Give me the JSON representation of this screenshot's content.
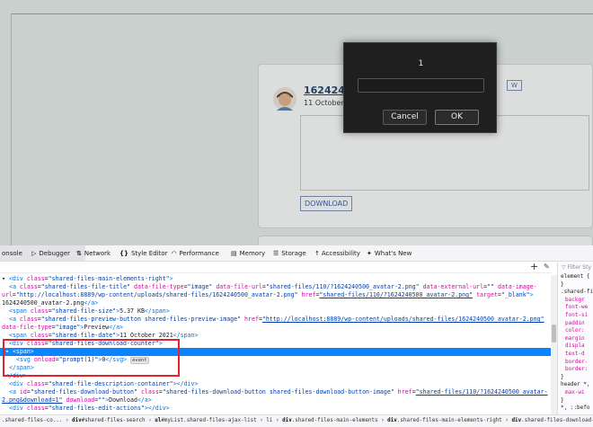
{
  "page": {
    "file_title": "16242405",
    "file_date": "11 October 20",
    "preview_label": "W",
    "download_label": "DOWNLOAD"
  },
  "prompt": {
    "message": "1",
    "input_value": "",
    "cancel_label": "Cancel",
    "ok_label": "OK"
  },
  "devtools": {
    "tabs": [
      "onsole",
      "Debugger",
      "Network",
      "Style Editor",
      "Performance",
      "Memory",
      "Storage",
      "Accessibility",
      "What's New"
    ],
    "tab_icons": [
      "debugger-icon",
      "network-icon",
      "style-editor-icon",
      "performance-icon",
      "memory-icon",
      "storage-icon",
      "accessibility-icon",
      "whats-new-icon"
    ],
    "styles_filter": "Filter Sty",
    "styles_lines": [
      "element {",
      "}",
      ".shared-fi",
      "backgr",
      "font-we",
      "font-si",
      "paddin",
      "color:",
      "margin",
      "displa",
      "text-d",
      "border-",
      "border:",
      "}",
      "header *,",
      "max-wi",
      "}",
      "*, ::befo"
    ],
    "code_lines": [
      {
        "ind": 0,
        "tri": "▾",
        "parts": [
          [
            "tg",
            "<div "
          ],
          [
            "at",
            "class"
          ],
          [
            "tx",
            "="
          ],
          [
            "vl",
            "\"shared-files-main-elements-right\""
          ],
          [
            "tg",
            ">"
          ]
        ]
      },
      {
        "ind": 2,
        "parts": [
          [
            "tg",
            "<a "
          ],
          [
            "at",
            "class"
          ],
          [
            "tx",
            "="
          ],
          [
            "vl",
            "\"shared-files-file-title\" "
          ],
          [
            "at",
            "data-file-type"
          ],
          [
            "tx",
            "="
          ],
          [
            "vl",
            "\"image\" "
          ],
          [
            "at",
            "data-file-url"
          ],
          [
            "tx",
            "="
          ],
          [
            "vl",
            "\"shared-files/110/?1624240500_avatar-2.png\" "
          ],
          [
            "at",
            "data-external-url"
          ],
          [
            "tx",
            "="
          ],
          [
            "vl",
            "\"\" "
          ],
          [
            "at",
            "data-image-"
          ]
        ]
      },
      {
        "ind": 0,
        "parts": [
          [
            "at",
            "url"
          ],
          [
            "tx",
            "="
          ],
          [
            "vl",
            "\"http://localhost:8889/wp-content/uploads/shared-files/1624240500_avatar-2.png\" "
          ],
          [
            "at",
            "href"
          ],
          [
            "tx",
            "="
          ],
          [
            "lk",
            "\"shared-files/110/?1624240500_avatar-2.png\""
          ],
          [
            "tx",
            " "
          ],
          [
            "at",
            "target"
          ],
          [
            "tx",
            "="
          ],
          [
            "vl",
            "\"_blank\""
          ],
          [
            "tg",
            ">"
          ]
        ]
      },
      {
        "ind": 0,
        "parts": [
          [
            "tx",
            "1624240500_avatar-2.png"
          ],
          [
            "tg",
            "</a>"
          ]
        ]
      },
      {
        "ind": 2,
        "parts": [
          [
            "tg",
            "<span "
          ],
          [
            "at",
            "class"
          ],
          [
            "tx",
            "="
          ],
          [
            "vl",
            "\"shared-file-size\""
          ],
          [
            "tg",
            ">"
          ],
          [
            "tx",
            "5.37 KB"
          ],
          [
            "tg",
            "</span>"
          ]
        ]
      },
      {
        "ind": 2,
        "parts": [
          [
            "tg",
            "<a "
          ],
          [
            "at",
            "class"
          ],
          [
            "tx",
            "="
          ],
          [
            "vl",
            "\"shared-files-preview-button shared-files-preview-image\" "
          ],
          [
            "at",
            "href"
          ],
          [
            "tx",
            "="
          ],
          [
            "lk",
            "\"http://localhost:8889/wp-content/uploads/shared-files/1624240500_avatar-2.png\""
          ]
        ]
      },
      {
        "ind": 0,
        "parts": [
          [
            "at",
            "data-file-type"
          ],
          [
            "tx",
            "="
          ],
          [
            "vl",
            "\"image\""
          ],
          [
            "tg",
            ">"
          ],
          [
            "tx",
            "Preview"
          ],
          [
            "tg",
            "</a>"
          ]
        ]
      },
      {
        "ind": 2,
        "parts": [
          [
            "tg",
            "<span "
          ],
          [
            "at",
            "class"
          ],
          [
            "tx",
            "="
          ],
          [
            "vl",
            "\"shared-file-date\""
          ],
          [
            "tg",
            ">"
          ],
          [
            "tx",
            "11 October 2021"
          ],
          [
            "tg",
            "</span>"
          ]
        ]
      },
      {
        "ind": 0,
        "tri": "▾",
        "parts": [
          [
            "tg",
            "<div "
          ],
          [
            "at",
            "class"
          ],
          [
            "tx",
            "="
          ],
          [
            "vl",
            "\"shared-files-download-counter\""
          ],
          [
            "tg",
            ">"
          ]
        ]
      },
      {
        "ind": 1,
        "tri": "▾",
        "sel": true,
        "parts": [
          [
            "tg",
            "<span>"
          ]
        ]
      },
      {
        "ind": 4,
        "parts": [
          [
            "tg",
            "<svg "
          ],
          [
            "at",
            "onload"
          ],
          [
            "tx",
            "="
          ],
          [
            "vl",
            "\"prompt(1)\""
          ],
          [
            "tg",
            ">"
          ],
          [
            "tx",
            "0"
          ],
          [
            "tg",
            "</svg>"
          ],
          [
            "tx",
            " "
          ],
          [
            "badge",
            "event"
          ]
        ]
      },
      {
        "ind": 2,
        "parts": [
          [
            "tg",
            "</span>"
          ]
        ]
      },
      {
        "ind": 1,
        "parts": [
          [
            "tg",
            "</div>"
          ]
        ]
      },
      {
        "ind": 2,
        "parts": [
          [
            "tg",
            "<div "
          ],
          [
            "at",
            "class"
          ],
          [
            "tx",
            "="
          ],
          [
            "vl",
            "\"shared-file-description-container\""
          ],
          [
            "tg",
            "></div>"
          ]
        ]
      },
      {
        "ind": 2,
        "parts": [
          [
            "tg",
            "<a "
          ],
          [
            "at",
            "id"
          ],
          [
            "tx",
            "="
          ],
          [
            "vl",
            "\"shared-files-download-button\" "
          ],
          [
            "at",
            "class"
          ],
          [
            "tx",
            "="
          ],
          [
            "vl",
            "\"shared-files-download-button shared-files-download-button-image\" "
          ],
          [
            "at",
            "href"
          ],
          [
            "tx",
            "="
          ],
          [
            "lk",
            "\"shared-files/110/?1624240500_avatar-"
          ]
        ]
      },
      {
        "ind": 0,
        "parts": [
          [
            "lk",
            "2.png&download=1\""
          ],
          [
            "tx",
            " "
          ],
          [
            "at",
            "download"
          ],
          [
            "tx",
            "="
          ],
          [
            "vl",
            "\"\""
          ],
          [
            "tg",
            ">"
          ],
          [
            "tx",
            "Download"
          ],
          [
            "tg",
            "</a>"
          ]
        ]
      },
      {
        "ind": 2,
        "parts": [
          [
            "tg",
            "<div "
          ],
          [
            "at",
            "class"
          ],
          [
            "tx",
            "="
          ],
          [
            "vl",
            "\"shared-files-edit-actions\""
          ],
          [
            "tg",
            "></div>"
          ]
        ]
      }
    ],
    "breadcrumbs": [
      {
        "pre": "",
        "name": ".shared-files-co..."
      },
      {
        "pre": "div",
        "name": "#shared-files-search"
      },
      {
        "pre": "ul",
        "name": "#myList.shared-files-ajax-list"
      },
      {
        "pre": "",
        "name": "li"
      },
      {
        "pre": "div",
        "name": ".shared-files-main-elements"
      },
      {
        "pre": "div",
        "name": ".shared-files-main-elements-right"
      },
      {
        "pre": "div",
        "name": ".shared-files-download-counter"
      },
      {
        "pre": "",
        "name": "span"
      }
    ]
  }
}
